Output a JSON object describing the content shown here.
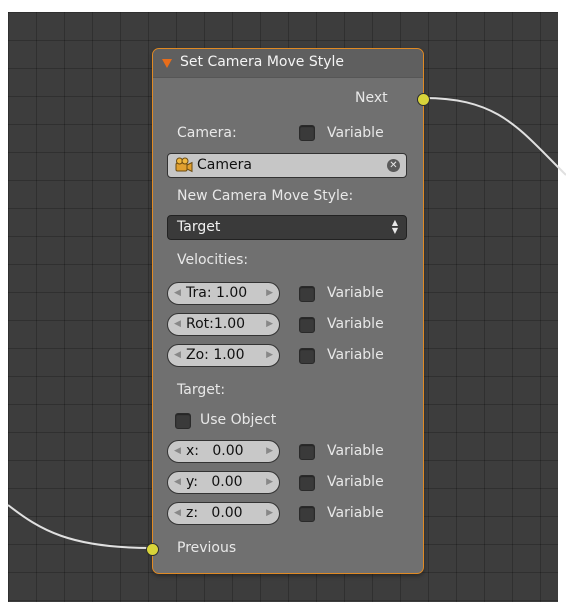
{
  "node": {
    "title": "Set Camera Move Style",
    "accent_color": "#e08a24",
    "socket_color": "#d8d43a",
    "outputs": [
      {
        "label": "Next"
      }
    ],
    "inputs": [
      {
        "label": "Previous"
      }
    ],
    "camera": {
      "label": "Camera:",
      "variable_label": "Variable",
      "variable_checked": false,
      "value": "Camera",
      "icon": "camera-object-icon",
      "clear_icon": "clear-x-icon"
    },
    "move_style": {
      "label": "New Camera Move Style:",
      "selected": "Target"
    },
    "velocities": {
      "label": "Velocities:",
      "fields": [
        {
          "text": "Tra: 1.00",
          "variable_label": "Variable",
          "variable_checked": false
        },
        {
          "text": "Rot:1.00",
          "variable_label": "Variable",
          "variable_checked": false
        },
        {
          "text": "Zo: 1.00",
          "variable_label": "Variable",
          "variable_checked": false
        }
      ]
    },
    "target": {
      "label": "Target:",
      "use_object_label": "Use Object",
      "use_object_checked": false,
      "fields": [
        {
          "text": "x:   0.00",
          "variable_label": "Variable",
          "variable_checked": false
        },
        {
          "text": "y:   0.00",
          "variable_label": "Variable",
          "variable_checked": false
        },
        {
          "text": "z:   0.00",
          "variable_label": "Variable",
          "variable_checked": false
        }
      ]
    }
  }
}
